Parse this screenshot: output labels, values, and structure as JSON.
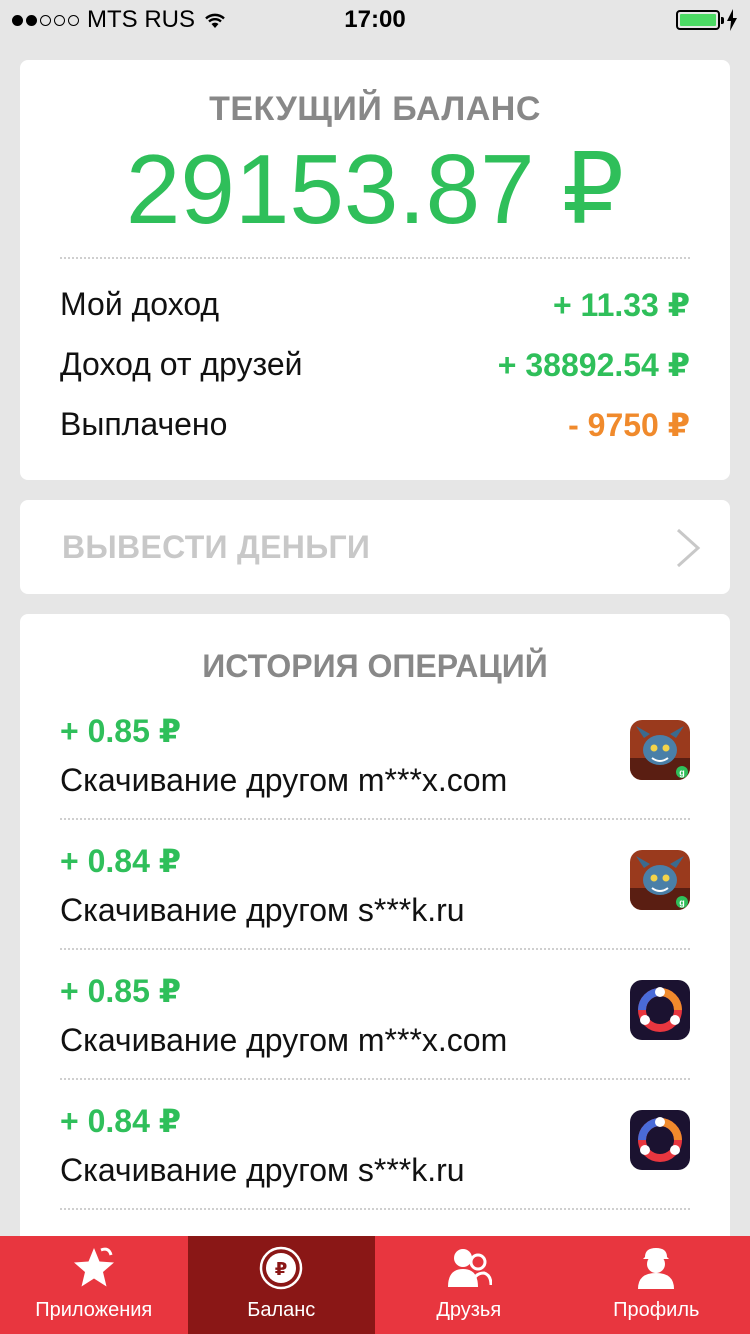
{
  "status_bar": {
    "carrier": "MTS RUS",
    "time": "17:00"
  },
  "balance": {
    "title": "ТЕКУЩИЙ БАЛАНС",
    "amount": "29153.87 ₽",
    "rows": [
      {
        "label": "Мой доход",
        "value": "+ 11.33 ₽",
        "color": "#2fbf5a"
      },
      {
        "label": "Доход от друзей",
        "value": "+ 38892.54 ₽",
        "color": "#2fbf5a"
      },
      {
        "label": "Выплачено",
        "value": "- 9750 ₽",
        "color": "#f08a2c"
      }
    ]
  },
  "withdraw": {
    "label": "ВЫВЕСТИ ДЕНЬГИ"
  },
  "history": {
    "title": "ИСТОРИЯ ОПЕРАЦИЙ",
    "items": [
      {
        "amount": "+ 0.85 ₽",
        "description": "Скачивание другом m***x.com",
        "icon": "dragon-game-icon"
      },
      {
        "amount": "+ 0.84 ₽",
        "description": "Скачивание другом s***k.ru",
        "icon": "dragon-game-icon"
      },
      {
        "amount": "+ 0.85 ₽",
        "description": "Скачивание другом m***x.com",
        "icon": "circle-app-icon"
      },
      {
        "amount": "+ 0.84 ₽",
        "description": "Скачивание другом s***k.ru",
        "icon": "circle-app-icon"
      }
    ]
  },
  "tabs": [
    {
      "label": "Приложения",
      "icon": "star-icon",
      "active": false
    },
    {
      "label": "Баланс",
      "icon": "ruble-coin-icon",
      "active": true
    },
    {
      "label": "Друзья",
      "icon": "friends-icon",
      "active": false
    },
    {
      "label": "Профиль",
      "icon": "profile-icon",
      "active": false
    }
  ],
  "colors": {
    "accent_green": "#2fbf5a",
    "accent_orange": "#f08a2c",
    "tab_bar": "#e8363f",
    "tab_active": "#8a1716"
  }
}
